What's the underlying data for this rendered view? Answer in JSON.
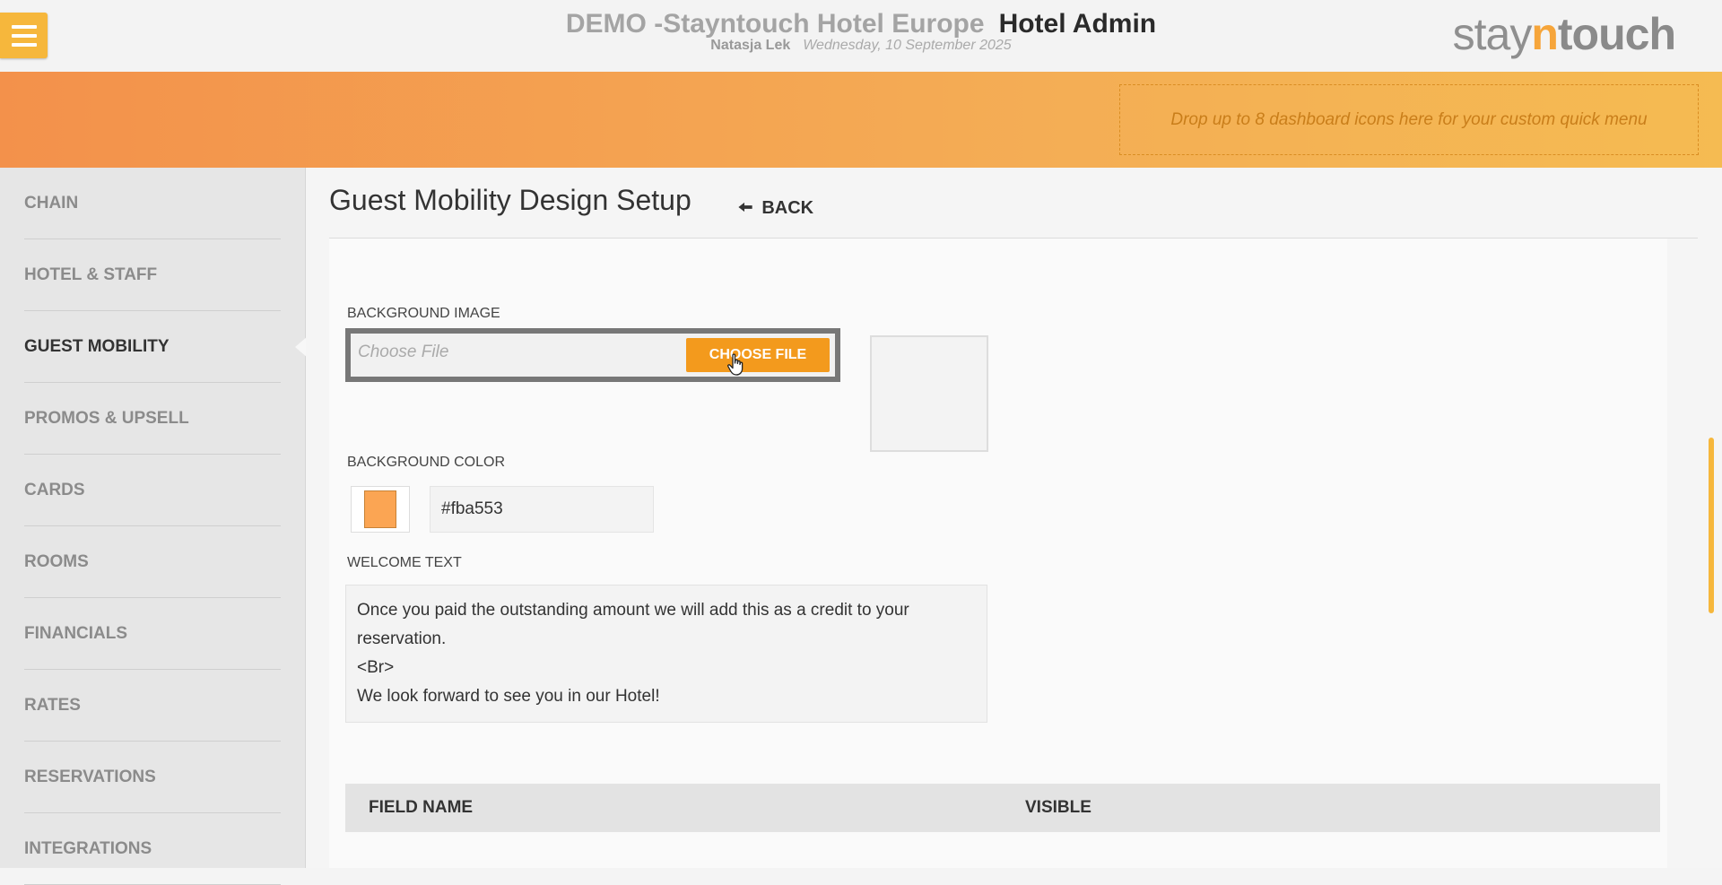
{
  "header": {
    "hotel_name": "DEMO -Stayntouch Hotel Europe",
    "app_name": "Hotel Admin",
    "user_name": "Natasja Lek",
    "date": "Wednesday, 10 September 2025",
    "logo": {
      "part1": "stay",
      "part2": "n",
      "part3": "touch"
    }
  },
  "quick_menu": {
    "placeholder": "Drop up to 8 dashboard icons here for your custom quick menu"
  },
  "sidebar": {
    "items": [
      {
        "label": "CHAIN"
      },
      {
        "label": "HOTEL & STAFF"
      },
      {
        "label": "GUEST MOBILITY",
        "active": true
      },
      {
        "label": "PROMOS & UPSELL"
      },
      {
        "label": "CARDS"
      },
      {
        "label": "ROOMS"
      },
      {
        "label": "FINANCIALS"
      },
      {
        "label": "RATES"
      },
      {
        "label": "RESERVATIONS"
      },
      {
        "label": "INTEGRATIONS"
      }
    ]
  },
  "page": {
    "title": "Guest Mobility Design Setup",
    "back_label": "BACK"
  },
  "form": {
    "background_image_label": "BACKGROUND IMAGE",
    "file_placeholder": "Choose File",
    "choose_file_button": "CHOOSE FILE",
    "background_color_label": "BACKGROUND COLOR",
    "background_color_value": "#fba553",
    "welcome_text_label": "WELCOME TEXT",
    "welcome_text_value": "Once you paid the outstanding amount we will add this as a credit to your reservation.\n<Br>\nWe look forward to see you in our Hotel!"
  },
  "table": {
    "columns": [
      "FIELD NAME",
      "VISIBLE"
    ]
  },
  "colors": {
    "accent": "#f39a1d",
    "swatch": "#fba553"
  }
}
